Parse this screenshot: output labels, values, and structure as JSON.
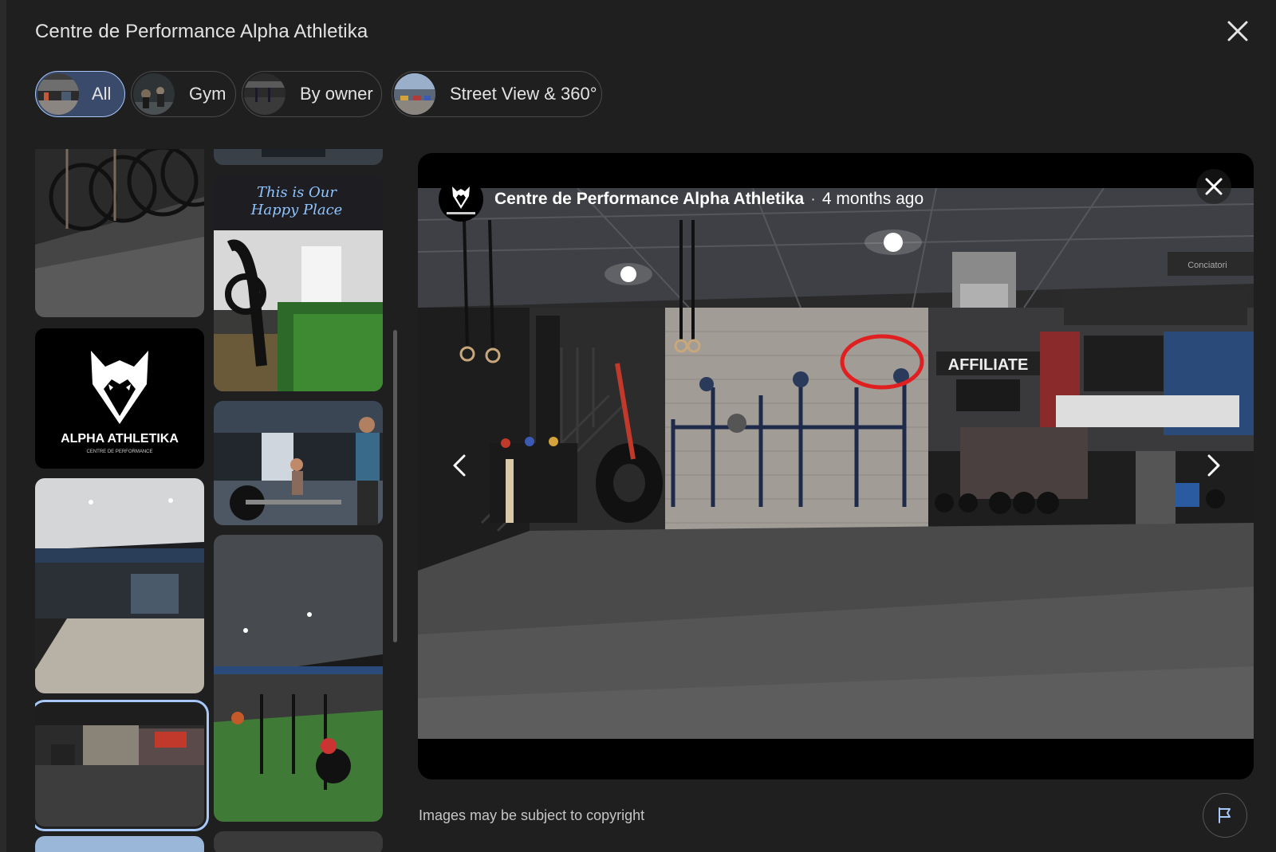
{
  "dialog": {
    "title": "Centre de Performance Alpha Athletika",
    "close_icon": "close-icon"
  },
  "filters": [
    {
      "label": "All",
      "active": true
    },
    {
      "label": "Gym",
      "active": false
    },
    {
      "label": "By owner",
      "active": false
    },
    {
      "label": "Street View & 360°",
      "active": false
    }
  ],
  "thumbnails": {
    "logo_text": "ALPHA ATHLETIKA",
    "logo_subtext": "CENTRE DE PERFORMANCE",
    "neon_text_line1": "This is Our",
    "neon_text_line2": "Happy Place"
  },
  "viewer": {
    "author": "Centre de Performance Alpha Athletika",
    "separator": "·",
    "time": "4 months ago",
    "sign_affiliate": "AFFILIATE",
    "sign_corner": "Conciatori",
    "prev_icon": "chevron-left-icon",
    "next_icon": "chevron-right-icon",
    "close_icon": "close-icon"
  },
  "footer": {
    "copyright": "Images may be subject to copyright",
    "report_icon": "flag-icon"
  },
  "colors": {
    "background": "#1f1f1f",
    "accent": "#a8c7fa",
    "active_chip": "#3a4a6a",
    "annotation": "#e02020"
  }
}
